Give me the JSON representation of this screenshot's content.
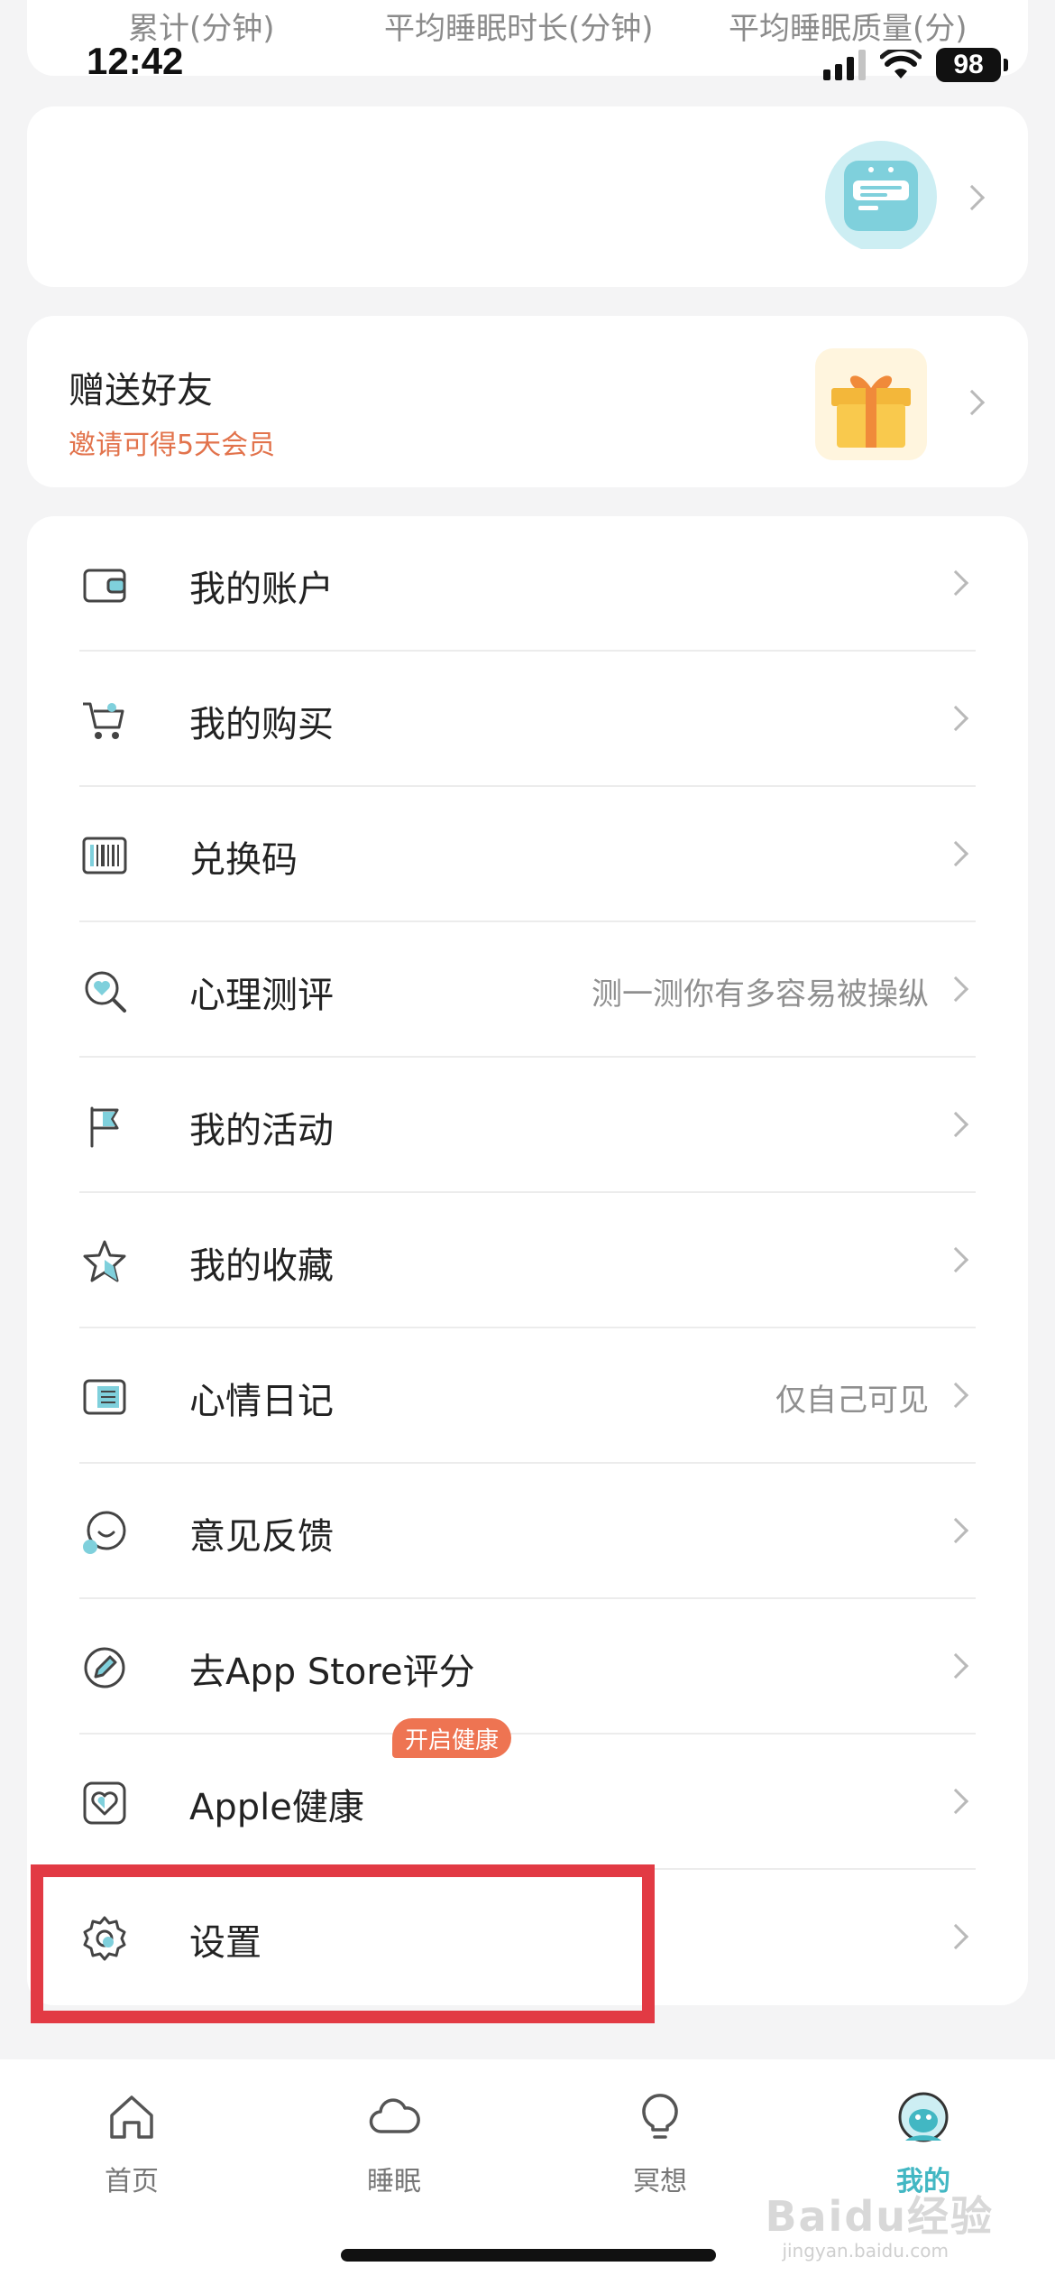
{
  "stats": {
    "labels": [
      "累计(分钟)",
      "平均睡眠时长(分钟)",
      "平均睡眠质量(分)"
    ]
  },
  "status_bar": {
    "time": "12:42",
    "battery": "98"
  },
  "invite": {
    "title": "赠送好友",
    "subtitle": "邀请可得5天会员"
  },
  "menu": {
    "items": [
      {
        "label": "我的账户",
        "icon": "wallet-icon",
        "hint": ""
      },
      {
        "label": "我的购买",
        "icon": "cart-icon",
        "hint": ""
      },
      {
        "label": "兑换码",
        "icon": "barcode-icon",
        "hint": ""
      },
      {
        "label": "心理测评",
        "icon": "heart-search-icon",
        "hint": "测一测你有多容易被操纵"
      },
      {
        "label": "我的活动",
        "icon": "flag-icon",
        "hint": ""
      },
      {
        "label": "我的收藏",
        "icon": "star-icon",
        "hint": ""
      },
      {
        "label": "心情日记",
        "icon": "journal-icon",
        "hint": "仅自己可见"
      },
      {
        "label": "意见反馈",
        "icon": "smile-chat-icon",
        "hint": ""
      },
      {
        "label": "去App Store评分",
        "icon": "pencil-circle-icon",
        "hint": ""
      },
      {
        "label": "Apple健康",
        "icon": "heart-square-icon",
        "hint": "",
        "badge": "开启健康"
      },
      {
        "label": "设置",
        "icon": "gear-icon",
        "hint": ""
      }
    ]
  },
  "tabs": [
    {
      "label": "首页",
      "icon": "home-icon",
      "active": false
    },
    {
      "label": "睡眠",
      "icon": "cloud-icon",
      "active": false
    },
    {
      "label": "冥想",
      "icon": "lightbulb-icon",
      "active": false
    },
    {
      "label": "我的",
      "icon": "profile-avatar-icon",
      "active": true
    }
  ],
  "watermark": {
    "text": "Baidu经验",
    "sub": "jingyan.baidu.com"
  },
  "colors": {
    "accent": "#42b7c3",
    "invite": "#e2734c",
    "badge": "#ee7452",
    "highlight": "#e23a44"
  }
}
